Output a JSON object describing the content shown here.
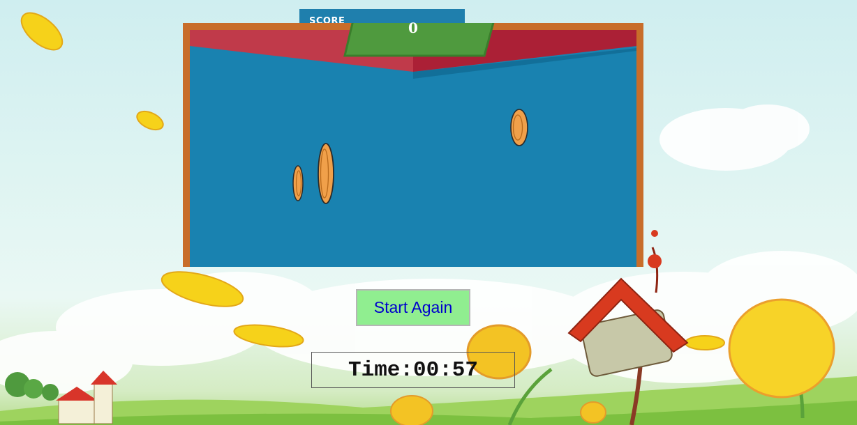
{
  "score_panel": {
    "label": "SCORE",
    "value": "0"
  },
  "controls": {
    "start_again_label": "Start Again"
  },
  "timer": {
    "label": "Time:",
    "value": "00:57"
  },
  "colors": {
    "board_frame": "#c86d2a",
    "board_field": "#1982b0",
    "banner_red": "#c03a4a",
    "score_box": "#4f9a3e",
    "coin": "#f0a04a",
    "button_bg": "#90ee90",
    "button_text": "#0000cd"
  }
}
